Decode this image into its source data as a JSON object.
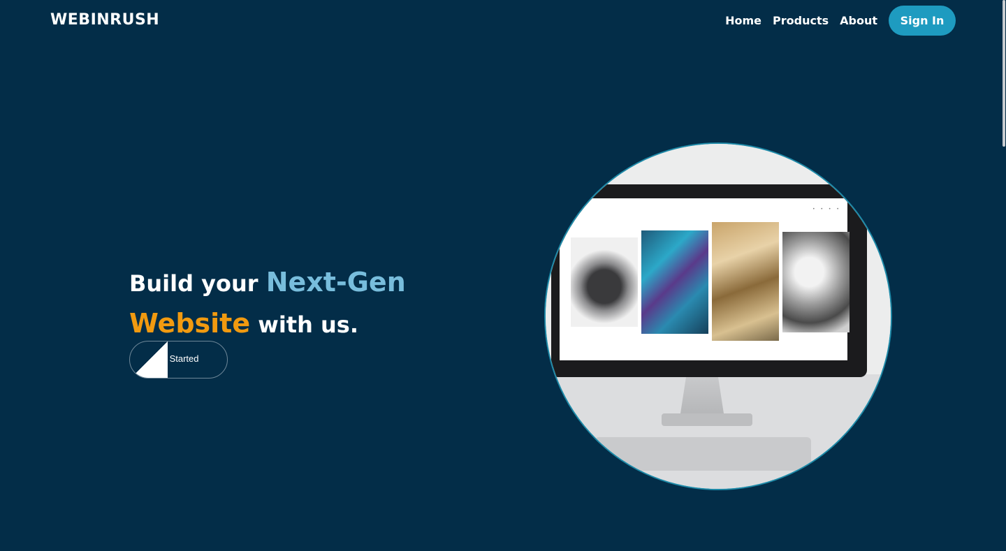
{
  "brand": {
    "logo_text": "WEBINRUSH"
  },
  "nav": {
    "links": [
      "Home",
      "Products",
      "About"
    ],
    "signin_label": "Sign In"
  },
  "hero": {
    "line1_plain": "Build your ",
    "line1_highlight": "Next-Gen",
    "line2_highlight": "Website",
    "line2_plain": " with us.",
    "cta_label": "Get Started"
  },
  "colors": {
    "background": "#032d48",
    "accent_blue": "#1e9bc0",
    "highlight_blue": "#78bddc",
    "highlight_orange": "#f19a10"
  },
  "icons": {
    "hero_image": "monitor-photo",
    "cta_wedge": "diagonal-wedge-icon"
  }
}
